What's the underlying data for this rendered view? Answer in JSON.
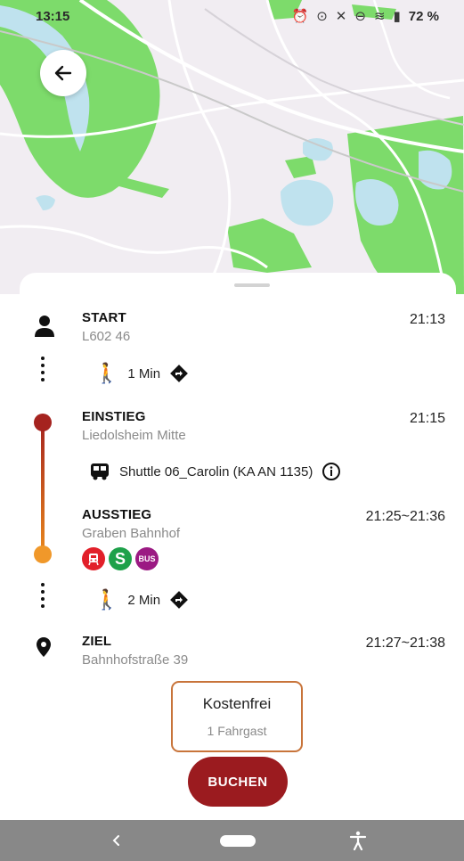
{
  "status_bar": {
    "time": "13:15",
    "battery": "72 %",
    "icons": [
      "alarm-icon",
      "location-icon",
      "mute-icon",
      "dnd-icon",
      "wifi-icon",
      "signal-icon",
      "battery-icon"
    ]
  },
  "colors": {
    "accent_red": "#9b1b1f",
    "accent_orange": "#e8871e",
    "price_border": "#c8743a",
    "map_green": "#7ddb6b",
    "map_water": "#bfe2ee"
  },
  "route": {
    "start": {
      "label": "START",
      "address": "L602 46",
      "time": "21:13"
    },
    "walk1": {
      "duration": "1 Min"
    },
    "boarding": {
      "label": "EINSTIEG",
      "stop": "Liedolsheim Mitte",
      "time": "21:15"
    },
    "vehicle": {
      "name": "Shuttle 06_Carolin (KA AN 1135)"
    },
    "alighting": {
      "label": "AUSSTIEG",
      "stop": "Graben Bahnhof",
      "time": "21:25~21:36",
      "transfer_badges": [
        "tram-icon",
        "s-bahn-icon",
        "bus-icon"
      ],
      "bus_badge_text": "BUS",
      "s_badge_text": "S"
    },
    "walk2": {
      "duration": "2 Min"
    },
    "destination": {
      "label": "ZIEL",
      "address": "Bahnhofstraße 39",
      "time": "21:27~21:38"
    }
  },
  "fare": {
    "price": "Kostenfrei",
    "passengers": "1 Fahrgast"
  },
  "book_button": "BUCHEN"
}
